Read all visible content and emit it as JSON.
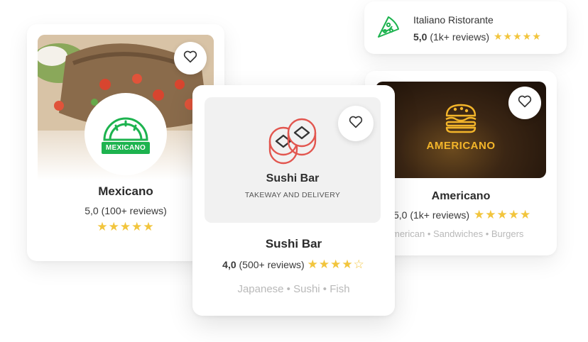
{
  "colors": {
    "star": "#f2c53d",
    "mexicano_green": "#1db34f",
    "sushi_red": "#e2564f",
    "americano_gold": "#f3b52a",
    "muted_text": "#b9b9b9"
  },
  "restaurants": {
    "mexicano": {
      "logo_text": "MEXICANO",
      "title": "Mexicano",
      "score": "5,0",
      "reviews": "(100+ reviews)",
      "stars": "★★★★★",
      "icon": "taco-icon"
    },
    "italiano": {
      "title": "Italiano Ristorante",
      "score": "5,0",
      "reviews": "(1k+ reviews)",
      "stars": "★★★★★",
      "icon": "pizza-slice-icon"
    },
    "americano": {
      "logo_text": "AMERICANO",
      "title": "Americano",
      "score": "5,0",
      "reviews": "(1k+ reviews)",
      "stars": "★★★★★",
      "tags": "merican • Sandwiches • Burgers",
      "icon": "burger-icon"
    },
    "sushi": {
      "banner_title": "Sushi Bar",
      "banner_subtitle": "TAKEWAY AND DELIVERY",
      "title": "Sushi Bar",
      "score": "4,0",
      "reviews": "(500+ reviews)",
      "stars_full": "★★★★",
      "stars_empty": "☆",
      "tags": "Japanese • Sushi • Fish",
      "icon": "sushi-roll-icon"
    }
  },
  "actions": {
    "favorite_icon": "heart-icon"
  }
}
